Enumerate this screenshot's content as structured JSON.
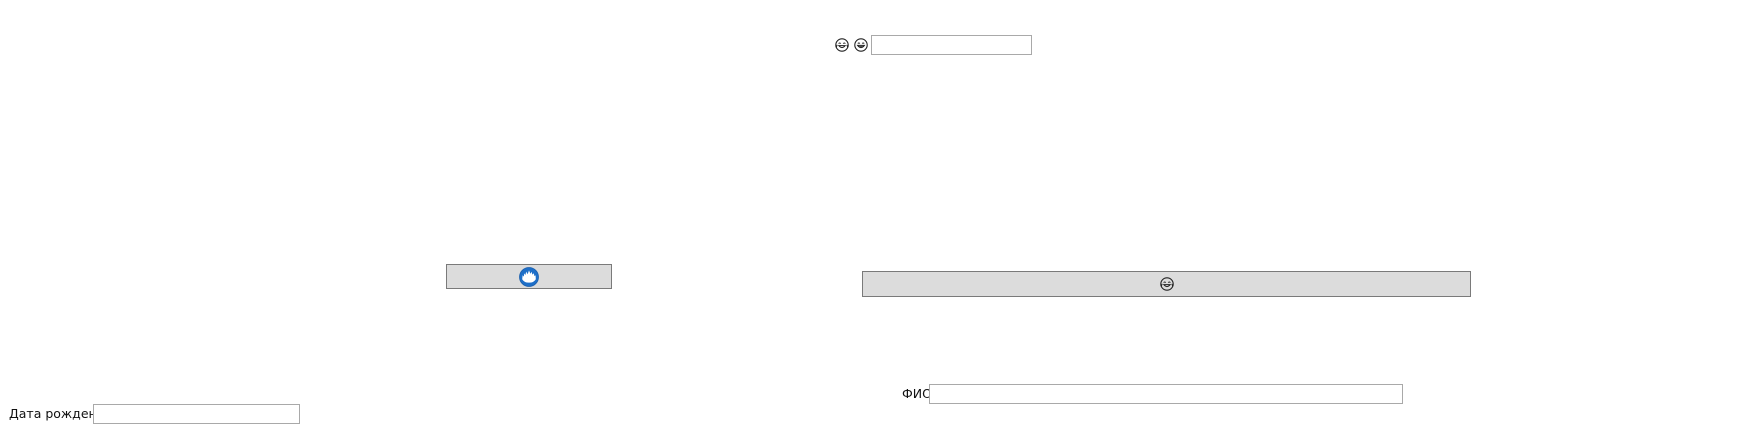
{
  "top_row": {
    "icons": [
      "laughing-emoji-icon",
      "grinning-emoji-icon"
    ],
    "input_value": "",
    "input_placeholder": ""
  },
  "left_button": {
    "icon": "blue-globe-icon",
    "icon_color": "#1e6fc8"
  },
  "wide_button": {
    "icon": "laughing-emoji-icon"
  },
  "fio_field": {
    "label": "ФИО",
    "value": "",
    "placeholder": ""
  },
  "birthdate_field": {
    "label": "Дата рождения",
    "value": "",
    "placeholder": ""
  },
  "colors": {
    "button_bg": "#dcdcdc",
    "button_border": "#7a7a7a",
    "input_border": "#a9a9a9",
    "background": "#ffffff"
  }
}
